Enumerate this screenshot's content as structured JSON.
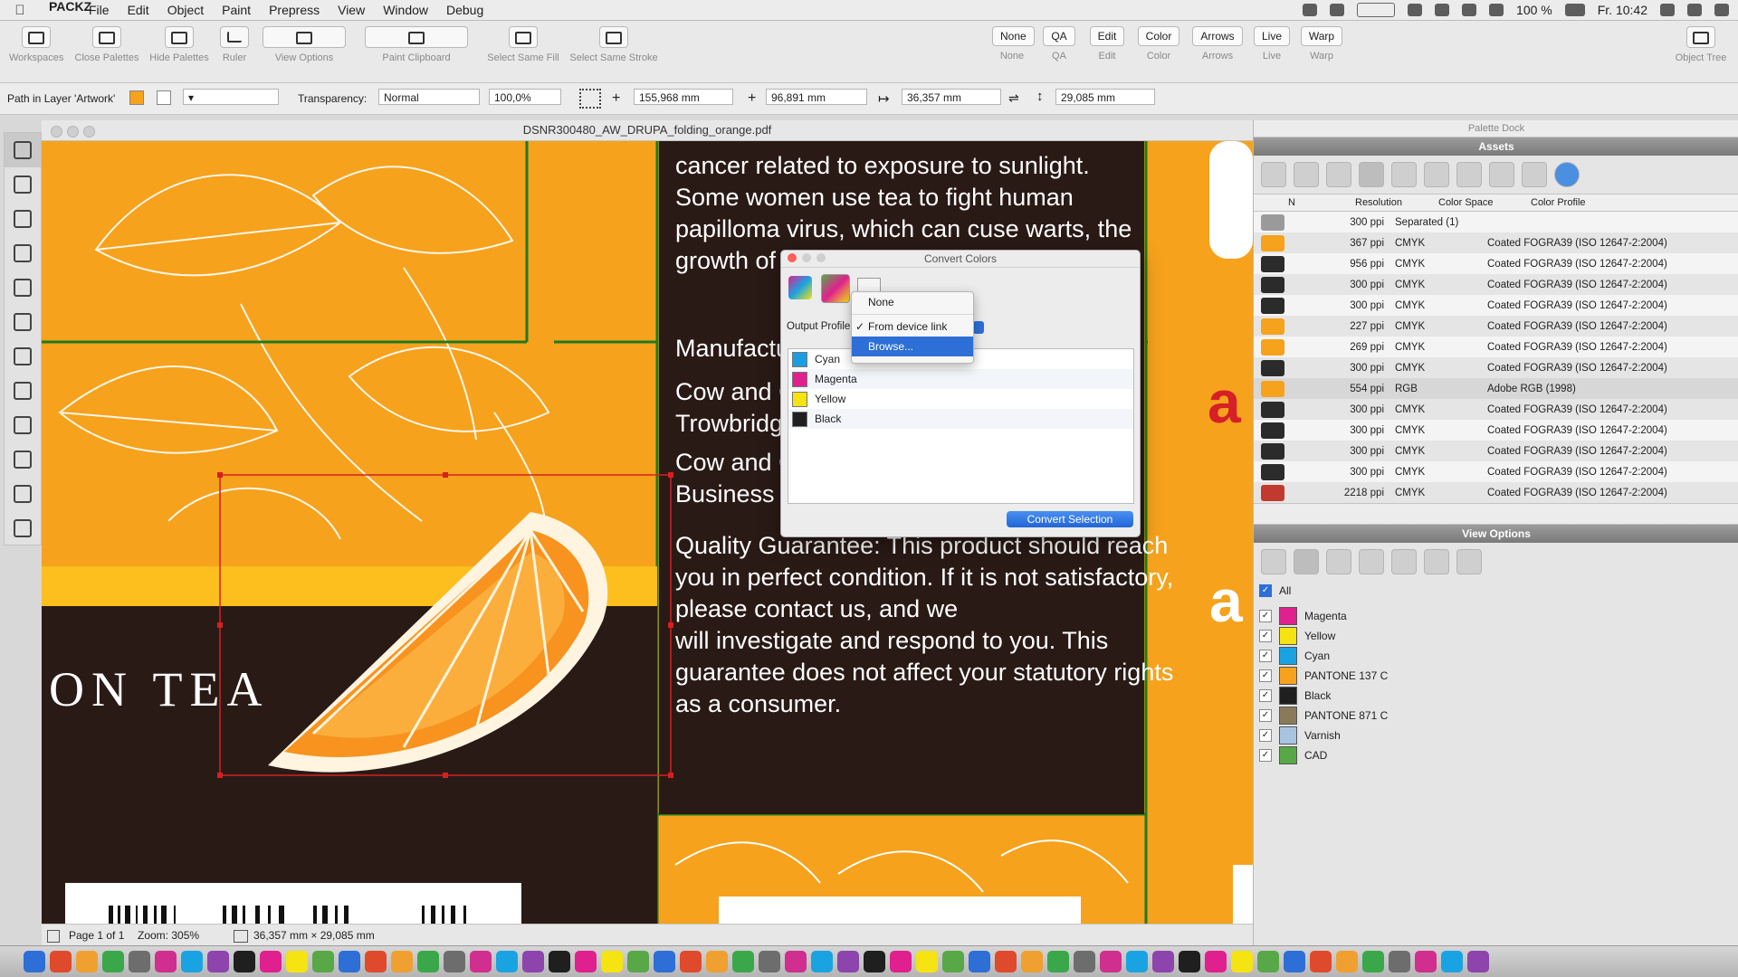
{
  "menubar": {
    "apple": "",
    "app_name": "PACKZ",
    "items": [
      "File",
      "Edit",
      "Object",
      "Paint",
      "Prepress",
      "View",
      "Window",
      "Debug"
    ],
    "battery": "100 %",
    "clock": "Fr. 10:42"
  },
  "toolbar": {
    "groups": [
      {
        "label": "Workspaces"
      },
      {
        "label": "Close Palettes"
      },
      {
        "label": "Hide Palettes"
      },
      {
        "label": "Ruler"
      },
      {
        "label": "View Options"
      },
      {
        "label": "Paint Clipboard"
      },
      {
        "label": "Select Same Fill"
      },
      {
        "label": "Select Same Stroke"
      },
      {
        "label": "Object Tree"
      }
    ],
    "text_buttons": [
      {
        "top": "None",
        "bottom": "None"
      },
      {
        "top": "QA",
        "bottom": "QA"
      },
      {
        "top": "Edit",
        "bottom": "Edit"
      },
      {
        "top": "Color",
        "bottom": "Color"
      },
      {
        "top": "Arrows",
        "bottom": "Arrows"
      },
      {
        "top": "Live",
        "bottom": "Live"
      },
      {
        "top": "Warp",
        "bottom": "Warp"
      }
    ]
  },
  "propbar": {
    "path_label": "Path in Layer 'Artwork'",
    "transparency_label": "Transparency:",
    "blend_mode": "Normal",
    "opacity": "100,0%",
    "x": "155,968 mm",
    "y": "96,891 mm",
    "width": "36,357 mm",
    "height": "29,085 mm"
  },
  "document": {
    "title": "DSNR300480_AW_DRUPA_folding_orange.pdf",
    "status_page": "Page 1 of 1",
    "status_zoom": "Zoom: 305%",
    "status_size": "36,357 mm × 29,085 mm"
  },
  "artwork": {
    "text_block_1": [
      "cancer related to exposure to sunlight.",
      "Some women use tea to fight human",
      "papilloma virus, which can cuse warts, the",
      "growth of"
    ],
    "manufacturer": "Manufactu",
    "address_lines": [
      "Cow and G",
      "Trowbridge",
      "Cow and G",
      "Business P"
    ],
    "guarantee": [
      "Quality Guarantee: This product should reach",
      "you in perfect condition. If it is not satisfactory,",
      "please contact us, and we",
      "will investigate and respond to you. This",
      "guarantee does not affect your statutory rights",
      "as a consumer."
    ],
    "product_title": "ON TEA",
    "brand_letter": "a",
    "brand_letter_2": "a"
  },
  "dialog": {
    "title": "Convert Colors",
    "output_profile_label": "Output Profile",
    "inks": [
      {
        "name": "Cyan",
        "color": "#1a9ee0"
      },
      {
        "name": "Magenta",
        "color": "#e0208f"
      },
      {
        "name": "Yellow",
        "color": "#f5e312"
      },
      {
        "name": "Black",
        "color": "#1f1f1f"
      }
    ],
    "convert_button": "Convert Selection",
    "popup": {
      "items": [
        "None",
        "From device link",
        "Browse..."
      ],
      "checked": "From device link",
      "highlighted": "Browse..."
    }
  },
  "dock": {
    "title": "Palette Dock",
    "assets_title": "Assets",
    "columns": [
      "N",
      "Resolution",
      "Color Space",
      "Color Profile"
    ],
    "assets": [
      {
        "res": "300 ppi",
        "cs": "Separated (1)",
        "profile": ""
      },
      {
        "res": "367 ppi",
        "cs": "CMYK",
        "profile": "Coated FOGRA39 (ISO 12647-2:2004)"
      },
      {
        "res": "956 ppi",
        "cs": "CMYK",
        "profile": "Coated FOGRA39 (ISO 12647-2:2004)"
      },
      {
        "res": "300 ppi",
        "cs": "CMYK",
        "profile": "Coated FOGRA39 (ISO 12647-2:2004)"
      },
      {
        "res": "300 ppi",
        "cs": "CMYK",
        "profile": "Coated FOGRA39 (ISO 12647-2:2004)"
      },
      {
        "res": "227 ppi",
        "cs": "CMYK",
        "profile": "Coated FOGRA39 (ISO 12647-2:2004)"
      },
      {
        "res": "269 ppi",
        "cs": "CMYK",
        "profile": "Coated FOGRA39 (ISO 12647-2:2004)"
      },
      {
        "res": "300 ppi",
        "cs": "CMYK",
        "profile": "Coated FOGRA39 (ISO 12647-2:2004)"
      },
      {
        "res": "554 ppi",
        "cs": "RGB",
        "profile": "Adobe RGB (1998)"
      },
      {
        "res": "300 ppi",
        "cs": "CMYK",
        "profile": "Coated FOGRA39 (ISO 12647-2:2004)"
      },
      {
        "res": "300 ppi",
        "cs": "CMYK",
        "profile": "Coated FOGRA39 (ISO 12647-2:2004)"
      },
      {
        "res": "300 ppi",
        "cs": "CMYK",
        "profile": "Coated FOGRA39 (ISO 12647-2:2004)"
      },
      {
        "res": "300 ppi",
        "cs": "CMYK",
        "profile": "Coated FOGRA39 (ISO 12647-2:2004)"
      },
      {
        "res": "2218 ppi",
        "cs": "CMYK",
        "profile": "Coated FOGRA39 (ISO 12647-2:2004)"
      }
    ],
    "view_options_title": "View Options",
    "all_label": "All",
    "separations": [
      {
        "name": "Magenta",
        "color": "#e0208f"
      },
      {
        "name": "Yellow",
        "color": "#f5e312"
      },
      {
        "name": "Cyan",
        "color": "#1aa3e2"
      },
      {
        "name": "PANTONE 137 C",
        "color": "#f6a21c"
      },
      {
        "name": "Black",
        "color": "#1f1f1f"
      },
      {
        "name": "PANTONE 871 C",
        "color": "#8b7a5a"
      },
      {
        "name": "Varnish",
        "color": "#a8c4e0"
      },
      {
        "name": "CAD",
        "color": "#58a848"
      }
    ]
  }
}
